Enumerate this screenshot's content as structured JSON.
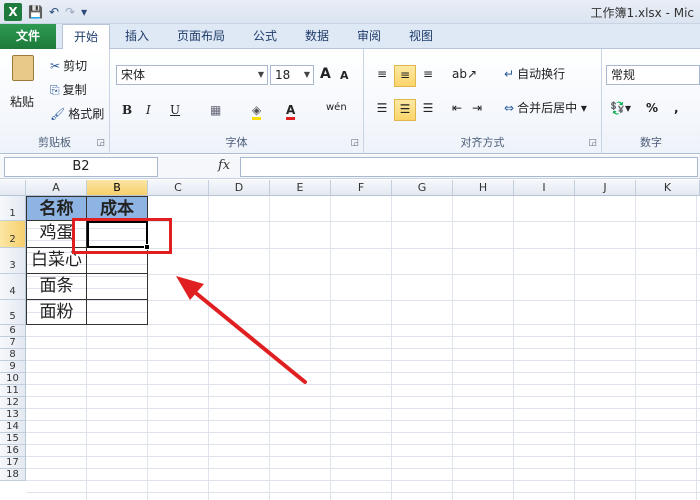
{
  "window": {
    "title": "工作簿1.xlsx - Mic",
    "app_icon": "X"
  },
  "qat": {
    "save": "💾",
    "undo": "↶",
    "redo": "↷",
    "customize": "▾"
  },
  "tabs": [
    {
      "label": "文件"
    },
    {
      "label": "开始"
    },
    {
      "label": "插入"
    },
    {
      "label": "页面布局"
    },
    {
      "label": "公式"
    },
    {
      "label": "数据"
    },
    {
      "label": "审阅"
    },
    {
      "label": "视图"
    }
  ],
  "ribbon": {
    "clipboard": {
      "paste": "粘贴",
      "cut": "剪切",
      "copy": "复制",
      "format_painter": "格式刷",
      "label": "剪贴板"
    },
    "font": {
      "name": "宋体",
      "size": "18",
      "grow": "A",
      "shrink": "A",
      "bold": "B",
      "italic": "I",
      "underline": "U",
      "wen": "wén",
      "label": "字体"
    },
    "alignment": {
      "wrap": "自动换行",
      "merge": "合并后居中",
      "label": "对齐方式"
    },
    "number": {
      "format": "常规",
      "percent": "%",
      "comma": ",",
      "label": "数字"
    }
  },
  "formula_bar": {
    "name_box": "B2",
    "fx": "fx",
    "value": ""
  },
  "columns": [
    "A",
    "B",
    "C",
    "D",
    "E",
    "F",
    "G",
    "H",
    "I",
    "J",
    "K"
  ],
  "rows": [
    "1",
    "2",
    "3",
    "4",
    "5",
    "6",
    "7",
    "8",
    "9",
    "10",
    "11",
    "12",
    "13",
    "14",
    "15",
    "16",
    "17",
    "18"
  ],
  "table": {
    "header": [
      "名称",
      "成本"
    ],
    "items": [
      "鸡蛋",
      "白菜心",
      "面条",
      "面粉"
    ]
  },
  "selection": {
    "cell": "B2",
    "column": "B",
    "row": "2"
  },
  "accent": {
    "excel_green": "#1e7a3d",
    "annotation_red": "#e02020",
    "header_fill": "#8db4e2"
  }
}
